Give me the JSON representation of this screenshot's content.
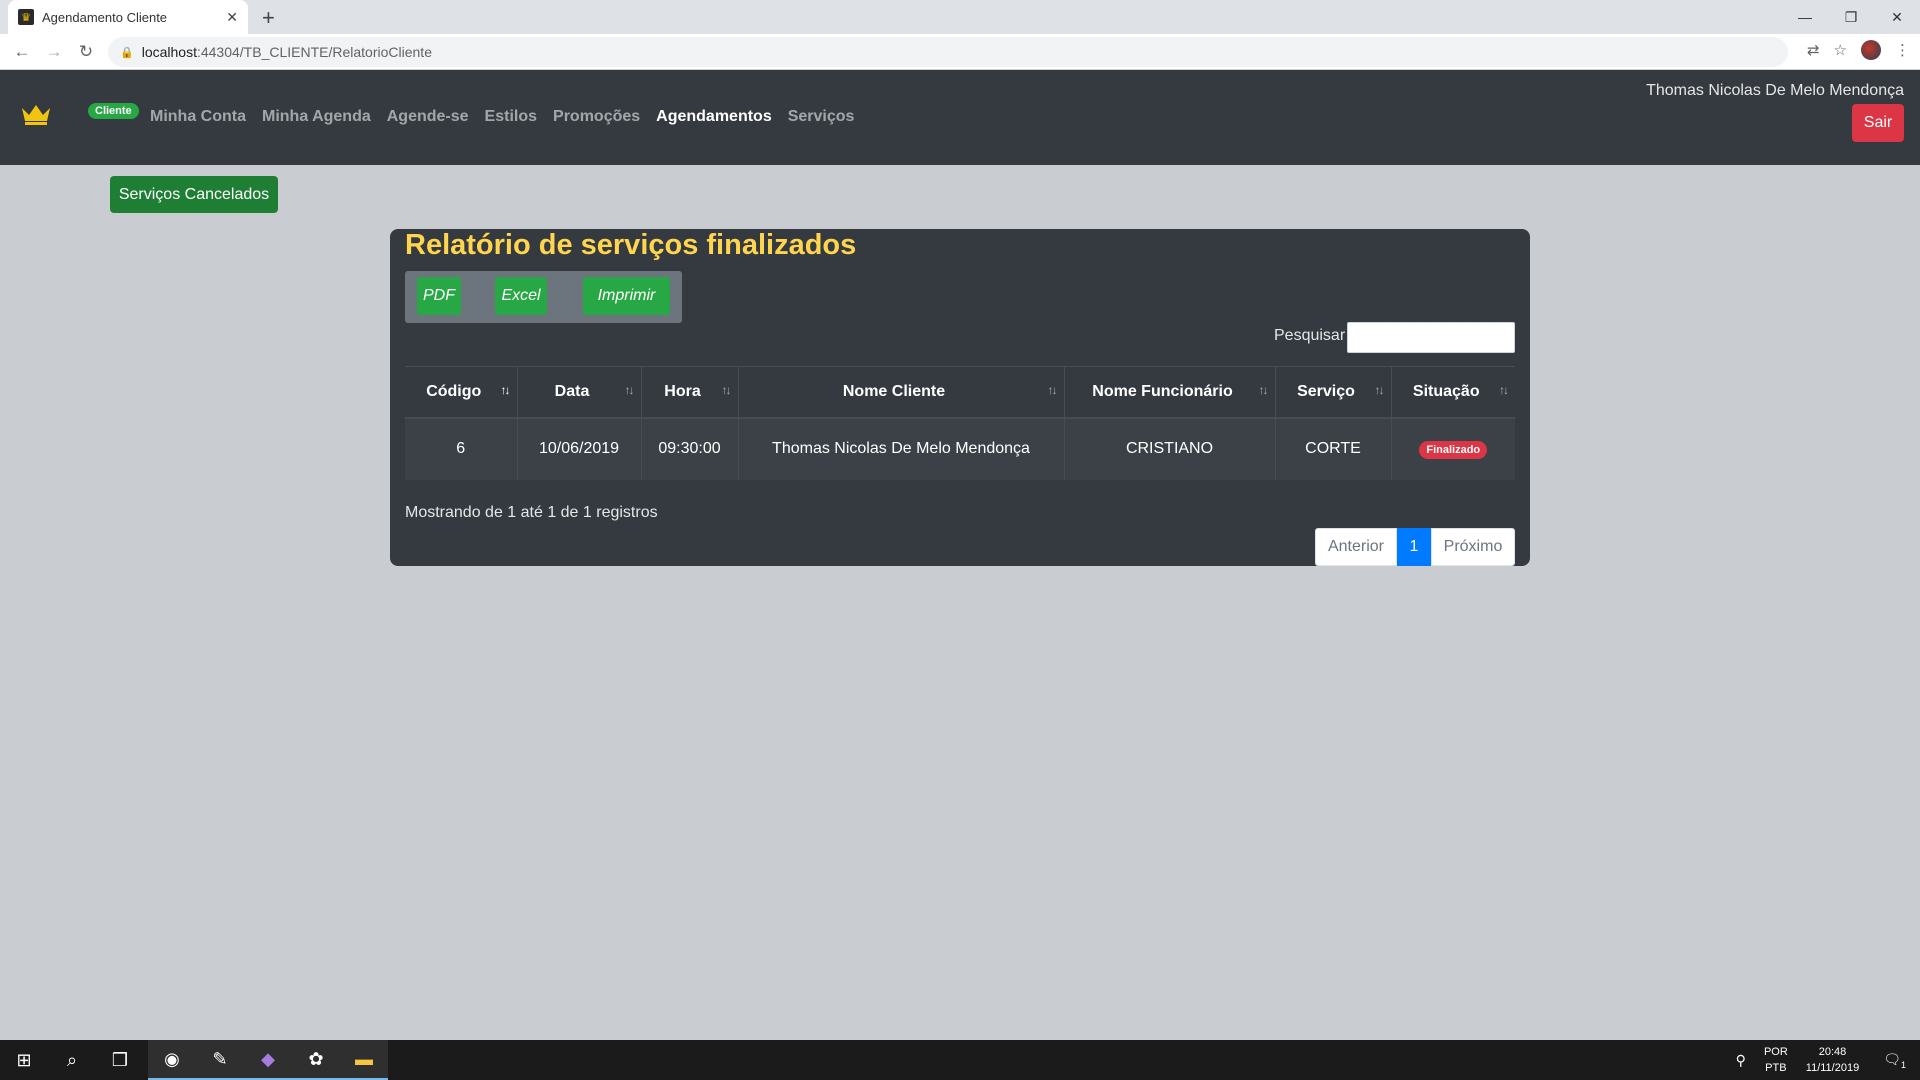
{
  "browser": {
    "tab_title": "Agendamento Cliente",
    "tab_close": "✕",
    "new_tab": "+",
    "url_host": "localhost",
    "url_path": ":44304/TB_CLIENTE/RelatorioCliente"
  },
  "navbar": {
    "badge": "Cliente",
    "links": [
      "Minha Conta",
      "Minha Agenda",
      "Agende-se",
      "Estilos",
      "Promoções",
      "Agendamentos",
      "Serviços"
    ],
    "active_link": "Agendamentos",
    "user_name": "Thomas Nicolas De Melo Mendonça",
    "logout_label": "Sair"
  },
  "cancel_button": "Serviços Cancelados",
  "report": {
    "title": "Relatório de serviços finalizados",
    "export_buttons": [
      "PDF",
      "Excel",
      "Imprimir"
    ],
    "search_label": "Pesquisar",
    "search_value": "",
    "columns": [
      "Código",
      "Data",
      "Hora",
      "Nome Cliente",
      "Nome Funcionário",
      "Serviço",
      "Situação"
    ],
    "rows": [
      {
        "codigo": "6",
        "data": "10/06/2019",
        "hora": "09:30:00",
        "cliente": "Thomas Nicolas De Melo Mendonça",
        "funcionario": "CRISTIANO",
        "servico": "CORTE",
        "situacao": "Finalizado"
      }
    ],
    "info": "Mostrando de 1 até 1 de 1 registros",
    "pagination": {
      "prev": "Anterior",
      "current": "1",
      "next": "Próximo"
    }
  },
  "taskbar": {
    "lang_line1": "POR",
    "lang_line2": "PTB",
    "time": "20:48",
    "date": "11/11/2019",
    "notification_count": "1"
  },
  "colors": {
    "navbar_bg": "#343a40",
    "title_yellow": "#ffd54f",
    "success": "#28a745",
    "danger": "#dc3545",
    "primary": "#007bff"
  }
}
